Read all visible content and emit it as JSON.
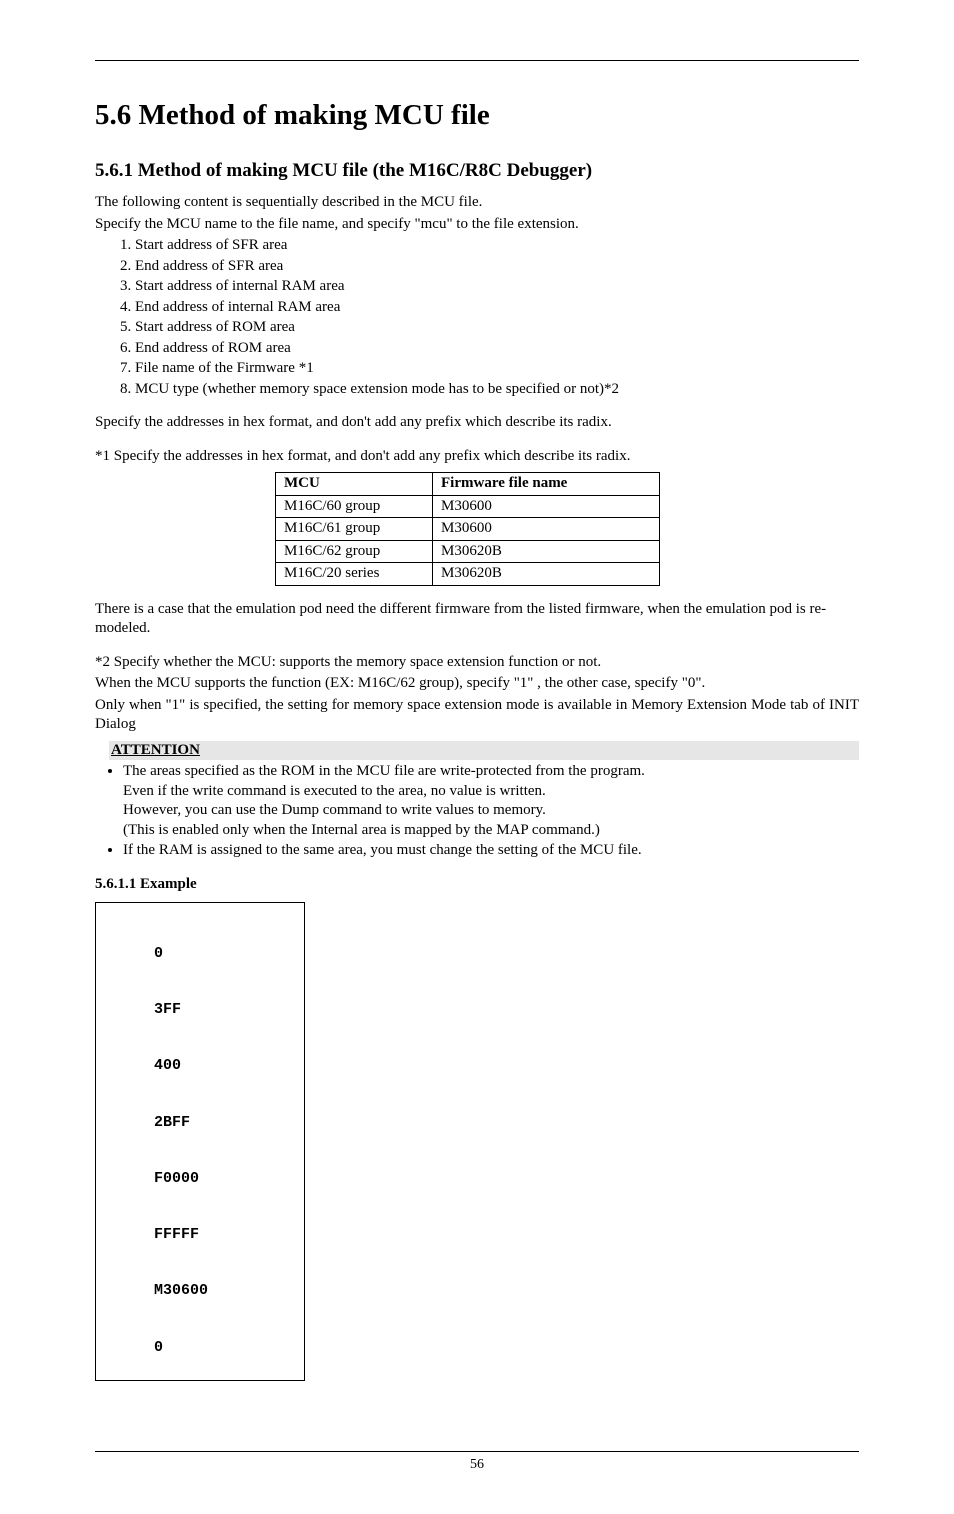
{
  "h1": "5.6 Method of making MCU file",
  "h2": "5.6.1 Method of making MCU file (the M16C/R8C Debugger)",
  "intro_p1": "The following content is sequentially described in the MCU file.",
  "intro_p2": "Specify the MCU name to the file name, and specify \"mcu\" to the file extension.",
  "list": [
    "Start address of SFR area",
    "End address of SFR area",
    "Start address of internal RAM area",
    "End address of internal RAM area",
    "Start address of ROM area",
    "End address of ROM area",
    "File name of the Firmware *1",
    "MCU type (whether memory space extension mode has to be specified or not)*2"
  ],
  "spec_line": "Specify the addresses in hex format, and don't add any prefix which describe its radix.",
  "star1_line": "*1 Specify the addresses in hex format, and don't add any prefix which describe its radix.",
  "table": {
    "headers": [
      "MCU",
      "Firmware file name"
    ],
    "rows": [
      [
        "M16C/60 group",
        "M30600"
      ],
      [
        "M16C/61 group",
        "M30600"
      ],
      [
        "M16C/62 group",
        "M30620B"
      ],
      [
        "M16C/20 series",
        "M30620B"
      ]
    ]
  },
  "after_table": "There is a case that the emulation pod need the different firmware from the listed firmware, when the emulation pod is re-modeled.",
  "star2_p1": "*2 Specify whether the MCU: supports the memory space extension function or not.",
  "star2_p2": "When the MCU supports the function (EX: M16C/62 group), specify \"1\" , the other case, specify \"0\".",
  "star2_p3": "Only when \"1\" is specified, the setting for memory space extension mode is available in Memory Extension Mode tab of INIT Dialog",
  "attention_label": "ATTENTION",
  "attention_bullet1_l1": "The areas specified as the ROM in the MCU file are write-protected from the program.",
  "attention_bullet1_l2": "Even if the write command is executed to the area, no value is written.",
  "attention_bullet1_l3": "However, you can use the Dump command to write values to memory.",
  "attention_bullet1_l4": "(This is enabled only when the Internal area is mapped by the MAP command.)",
  "attention_bullet2": "If the RAM is assigned to the same area, you must change the setting of the MCU file.",
  "h3": "5.6.1.1 Example",
  "example": [
    "0",
    "3FF",
    "400",
    "2BFF",
    "F0000",
    "FFFFF",
    "M30600",
    "0"
  ],
  "page_number": "56"
}
